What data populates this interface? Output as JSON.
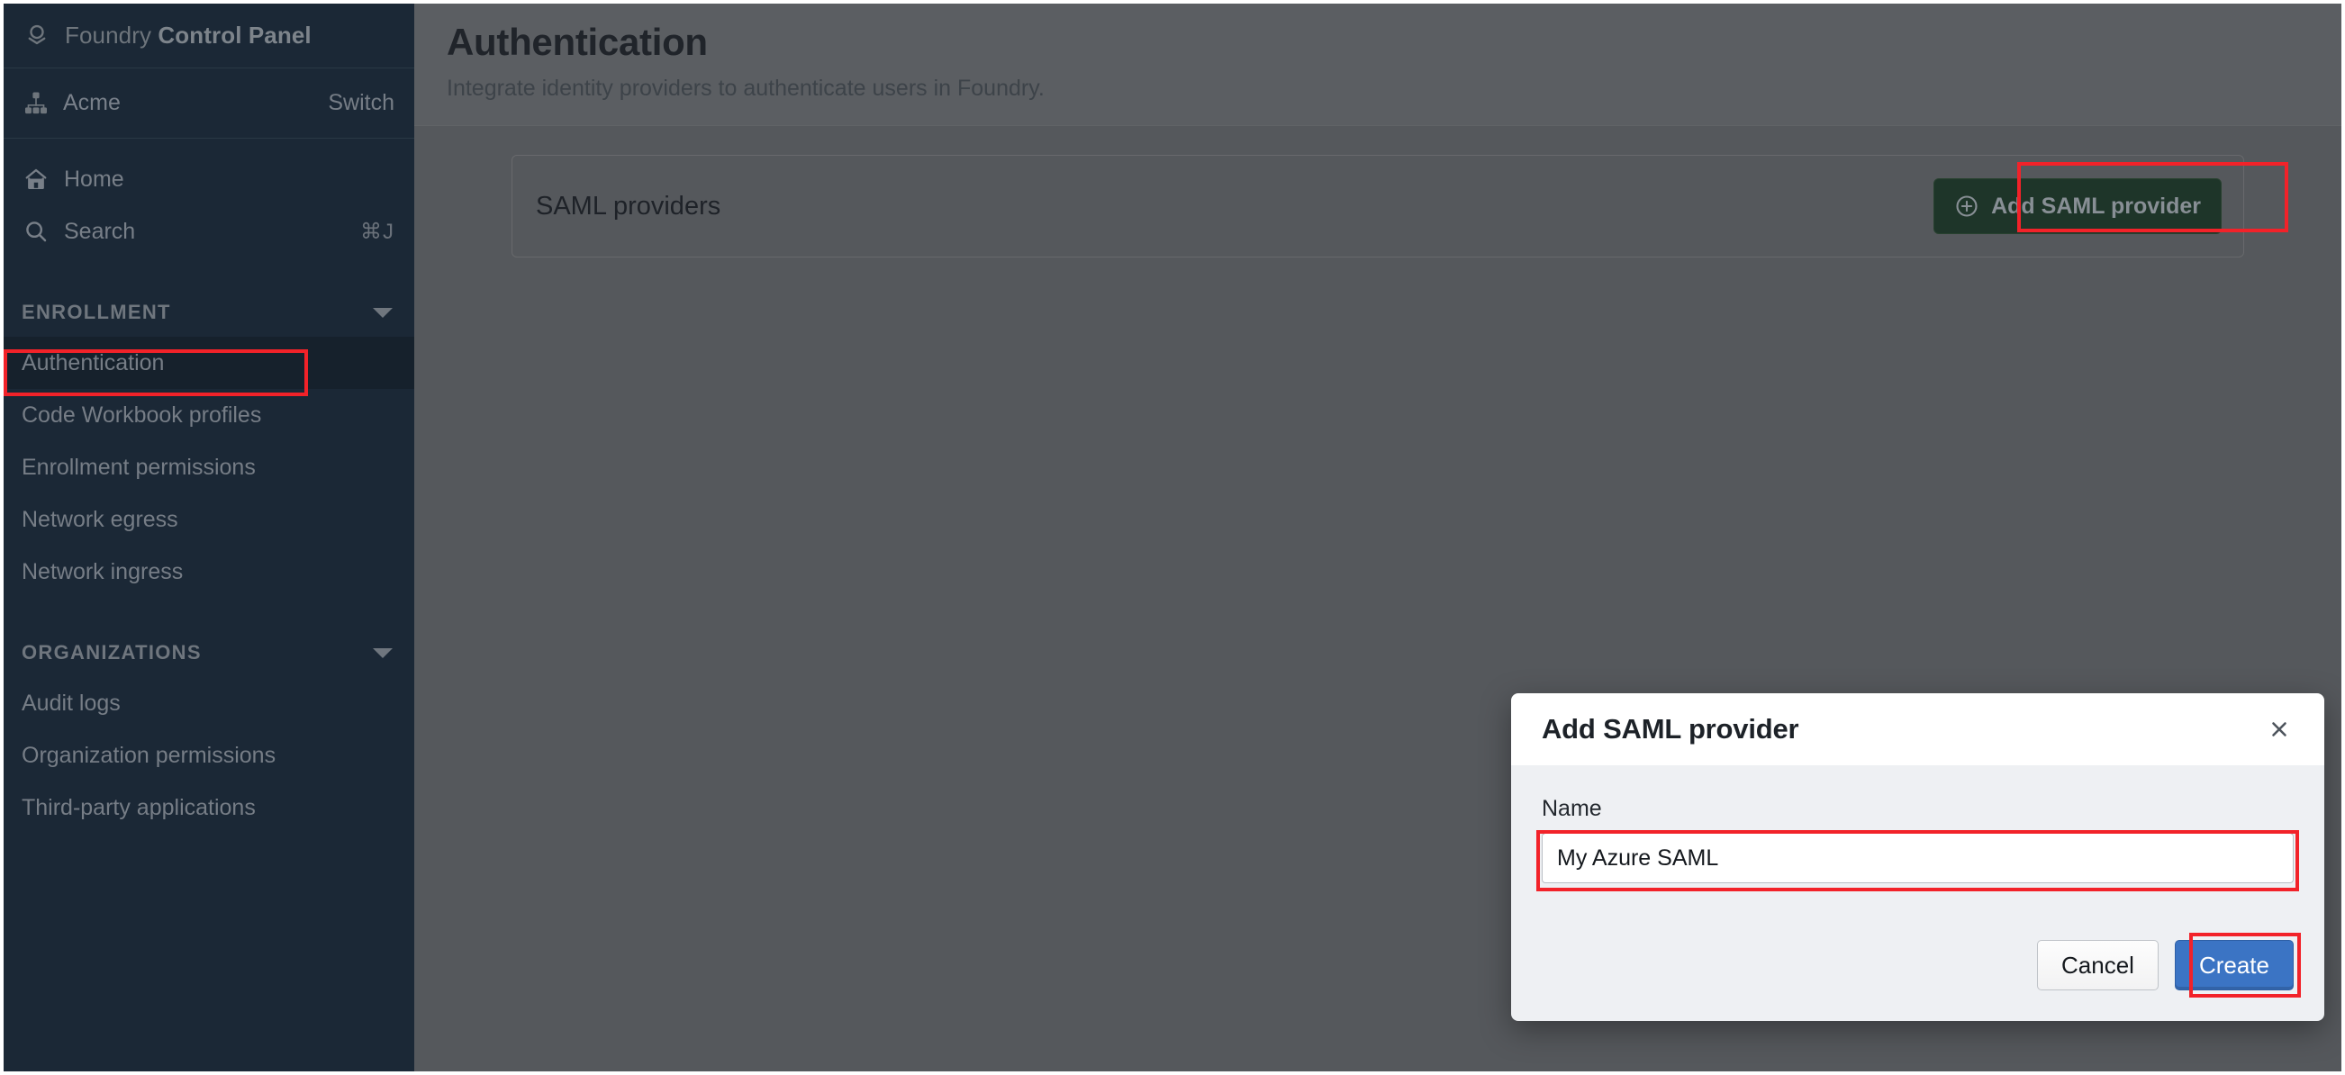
{
  "sidebar": {
    "brand": {
      "prefix": "Foundry ",
      "bold": "Control Panel",
      "icon": "foundry-logo-icon"
    },
    "org": {
      "name": "Acme",
      "switch_label": "Switch",
      "icon": "org-hierarchy-icon"
    },
    "links": [
      {
        "label": "Home",
        "icon": "home-icon",
        "shortcut": ""
      },
      {
        "label": "Search",
        "icon": "search-icon",
        "shortcut": "⌘J"
      }
    ],
    "sections": [
      {
        "label": "ENROLLMENT",
        "collapsed": false,
        "items": [
          {
            "label": "Authentication",
            "active": true
          },
          {
            "label": "Code Workbook profiles",
            "active": false
          },
          {
            "label": "Enrollment permissions",
            "active": false
          },
          {
            "label": "Network egress",
            "active": false
          },
          {
            "label": "Network ingress",
            "active": false
          }
        ]
      },
      {
        "label": "ORGANIZATIONS",
        "collapsed": false,
        "items": [
          {
            "label": "Audit logs",
            "active": false
          },
          {
            "label": "Organization permissions",
            "active": false
          },
          {
            "label": "Third-party applications",
            "active": false
          }
        ]
      }
    ]
  },
  "page": {
    "title": "Authentication",
    "subtitle": "Integrate identity providers to authenticate users in Foundry."
  },
  "card": {
    "title": "SAML providers",
    "add_button": {
      "label": "Add SAML provider",
      "icon": "plus-circle-icon"
    }
  },
  "modal": {
    "title": "Add SAML provider",
    "close_icon": "close-icon",
    "field": {
      "label": "Name",
      "value": "My Azure SAML",
      "placeholder": ""
    },
    "cancel_label": "Cancel",
    "create_label": "Create"
  },
  "colors": {
    "sidebar_bg": "#1b2836",
    "sidebar_active": "#16212c",
    "content_bg": "#55585c",
    "header_bg": "#5b5e62",
    "annotation_red": "#f22229",
    "add_button_bg": "#1e3529",
    "create_button_bg": "#3b74c4",
    "modal_header_bg": "#ffffff",
    "modal_body_bg": "#eef0f3"
  }
}
